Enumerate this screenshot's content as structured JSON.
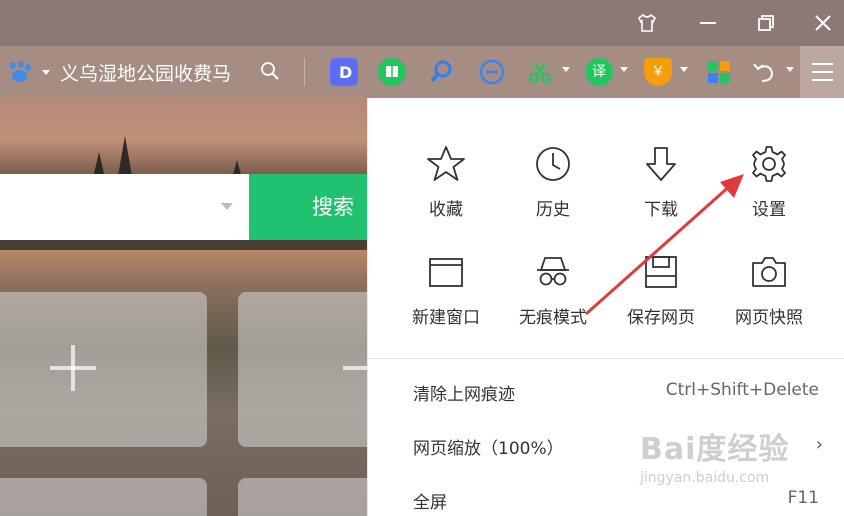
{
  "titlebar": {
    "buttons": [
      "skin",
      "minimize",
      "restore",
      "close"
    ]
  },
  "toolbar": {
    "search_text": "义乌湿地公园收费马",
    "extensions": [
      {
        "name": "doc-extension",
        "color": "#5b6cf5"
      },
      {
        "name": "reader-extension",
        "color": "#22c55e"
      },
      {
        "name": "search-extension",
        "color": "#3b82f6"
      },
      {
        "name": "minus-extension",
        "color": "#3b82f6"
      },
      {
        "name": "scissors-extension",
        "color": "#22c55e"
      },
      {
        "name": "translate-extension",
        "color": "#22c55e",
        "label": "译"
      },
      {
        "name": "shield-extension",
        "color": "#f59e0b",
        "label": "￥"
      },
      {
        "name": "apps-extension",
        "color": "#f59e0b"
      }
    ]
  },
  "page": {
    "search_button": "搜索"
  },
  "menu": {
    "grid": [
      {
        "label": "收藏",
        "icon": "star-icon"
      },
      {
        "label": "历史",
        "icon": "clock-icon"
      },
      {
        "label": "下载",
        "icon": "download-icon"
      },
      {
        "label": "设置",
        "icon": "gear-icon"
      },
      {
        "label": "新建窗口",
        "icon": "window-icon"
      },
      {
        "label": "无痕模式",
        "icon": "incognito-icon"
      },
      {
        "label": "保存网页",
        "icon": "save-icon"
      },
      {
        "label": "网页快照",
        "icon": "camera-icon"
      }
    ],
    "rows": [
      {
        "label": "清除上网痕迹",
        "shortcut": "Ctrl+Shift+Delete"
      },
      {
        "label": "网页缩放（100%）",
        "arrow": "›"
      },
      {
        "label": "全屏",
        "shortcut": "F11"
      }
    ]
  },
  "watermark": {
    "brand": "Bai度经验",
    "url": "jingyan.baidu.com"
  }
}
